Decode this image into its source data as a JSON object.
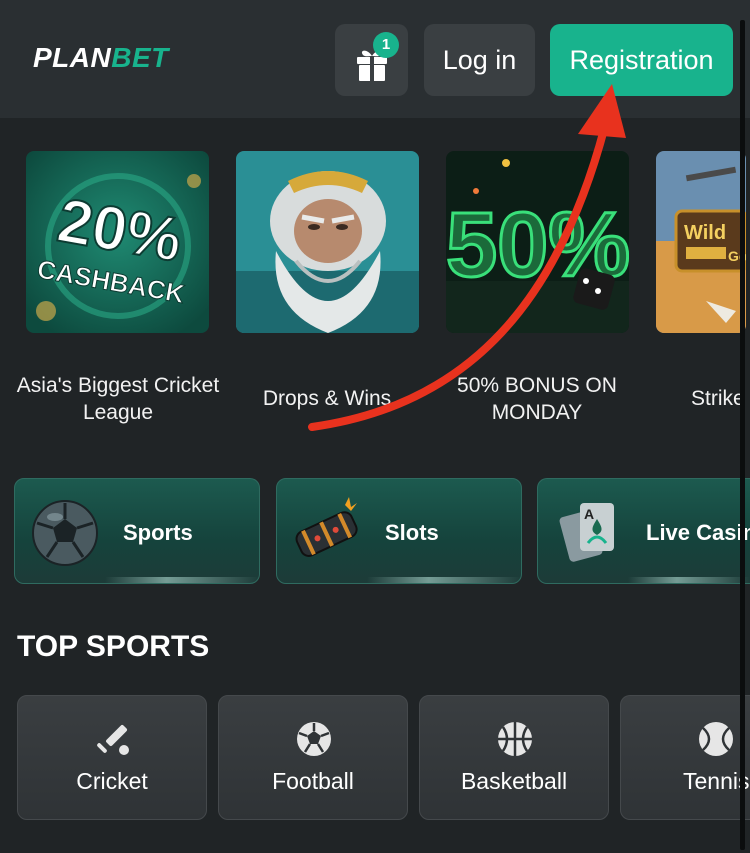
{
  "header": {
    "logo_plan": "PLAN",
    "logo_bet": "BET",
    "gift_badge": "1",
    "login_label": "Log in",
    "registration_label": "Registration",
    "accent": "#18b38d"
  },
  "promos": [
    {
      "title": "Asia's Biggest Cricket League",
      "art_text": "20%",
      "art_subtext": "CASHBACK"
    },
    {
      "title": "Drops & Wins"
    },
    {
      "title": "50% BONUS ON MONDAY",
      "art_text": "50%"
    },
    {
      "title": "Strike",
      "art_text": "Wild",
      "art_subtext": "Go"
    }
  ],
  "categories": [
    {
      "label": "Sports",
      "icon": "soccer-ball-icon"
    },
    {
      "label": "Slots",
      "icon": "slot-reel-icon"
    },
    {
      "label": "Live Casin",
      "icon": "playing-cards-icon"
    }
  ],
  "top_sports": {
    "title": "TOP SPORTS",
    "items": [
      {
        "label": "Cricket",
        "icon": "cricket-icon"
      },
      {
        "label": "Football",
        "icon": "football-icon"
      },
      {
        "label": "Basketball",
        "icon": "basketball-icon"
      },
      {
        "label": "Tennis",
        "icon": "tennis-icon"
      }
    ]
  },
  "annotation_color": "#e8321e"
}
